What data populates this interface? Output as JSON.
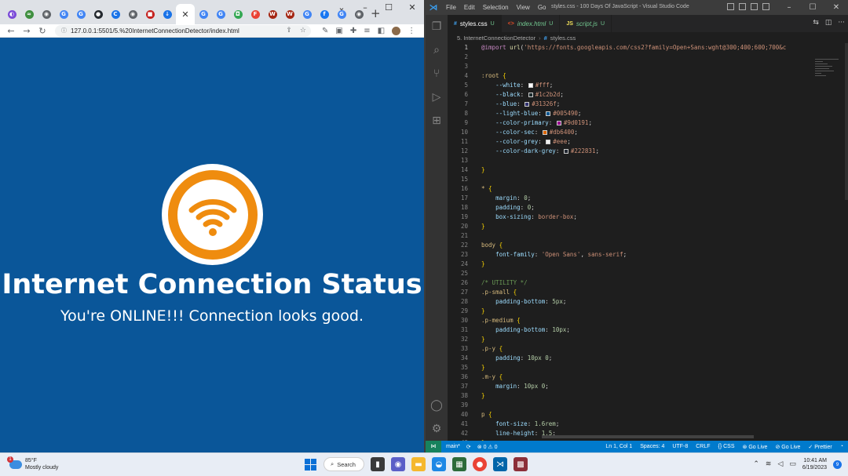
{
  "chrome": {
    "tabs": [
      {
        "icon": "tab-favicon-icon",
        "color": "#7b4bd8",
        "glyph": "◐"
      },
      {
        "icon": "tab-favicon-icon",
        "color": "#3f8f3f",
        "glyph": "≈"
      },
      {
        "icon": "tab-favicon-icon",
        "color": "#5f6368",
        "glyph": "◉"
      },
      {
        "icon": "google-icon",
        "color": "#4285f4",
        "glyph": "G"
      },
      {
        "icon": "google-icon",
        "color": "#4285f4",
        "glyph": "G"
      },
      {
        "icon": "github-icon",
        "color": "#24292f",
        "glyph": "●"
      },
      {
        "icon": "tab-favicon-icon",
        "color": "#1a73e8",
        "glyph": "C"
      },
      {
        "icon": "tab-favicon-icon",
        "color": "#5f6368",
        "glyph": "◉"
      },
      {
        "icon": "tab-favicon-icon",
        "color": "#c5221f",
        "glyph": "■"
      },
      {
        "icon": "download-icon",
        "color": "#1a73e8",
        "glyph": "↓"
      }
    ],
    "tabs_after": [
      {
        "icon": "google-icon",
        "color": "#4285f4",
        "glyph": "G"
      },
      {
        "icon": "google-icon",
        "color": "#4285f4",
        "glyph": "G"
      },
      {
        "icon": "tab-favicon-icon",
        "color": "#34a853",
        "glyph": "◘"
      },
      {
        "icon": "tab-favicon-icon",
        "color": "#ea4335",
        "glyph": "F"
      },
      {
        "icon": "tab-favicon-icon",
        "color": "#a52714",
        "glyph": "W"
      },
      {
        "icon": "tab-favicon-icon",
        "color": "#a52714",
        "glyph": "W"
      },
      {
        "icon": "google-icon",
        "color": "#4285f4",
        "glyph": "G"
      },
      {
        "icon": "facebook-icon",
        "color": "#1877f2",
        "glyph": "f"
      },
      {
        "icon": "google-icon",
        "color": "#4285f4",
        "glyph": "G"
      },
      {
        "icon": "tab-favicon-icon",
        "color": "#5f6368",
        "glyph": "◉"
      }
    ],
    "url": "127.0.0.1:5501/5.%20InternetConnectionDetector/index.html",
    "win_min": "⌄",
    "win_restore": "–",
    "win_max": "☐",
    "win_close": "✕"
  },
  "page": {
    "title": "Internet Connection Status",
    "status": "You're ONLINE!!! Connection looks good.",
    "accent": "#ef8c0f",
    "background": "#0a5699"
  },
  "vscode": {
    "menu": [
      "File",
      "Edit",
      "Selection",
      "View",
      "Go",
      "···"
    ],
    "window_title": "styles.css - 100 Days Of JavaScript - Visual Studio Code",
    "tabs": [
      {
        "label": "styles.css",
        "badge": "U",
        "type": "css",
        "active": true
      },
      {
        "label": "index.html",
        "badge": "U",
        "type": "html",
        "active": false
      },
      {
        "label": "script.js",
        "badge": "U",
        "type": "js",
        "active": false
      }
    ],
    "breadcrumb": [
      "5. InternetConnectionDetector",
      "styles.css"
    ],
    "status": {
      "branch": "main*",
      "sync": "⟳",
      "problems": "⊗ 0 ⚠ 0",
      "position": "Ln 1, Col 1",
      "spaces": "Spaces: 4",
      "encoding": "UTF-8",
      "eol": "CRLF",
      "language": "{} CSS",
      "golive1": "⊛ Go Live",
      "golive2": "⊘ Go Live",
      "prettier": "✓ Prettier",
      "bell": "🔔"
    }
  },
  "code_lines": [
    [
      {
        "c": "kw",
        "t": "@import"
      },
      {
        "c": "pun",
        "t": " "
      },
      {
        "c": "fn",
        "t": "url"
      },
      {
        "c": "pun",
        "t": "("
      },
      {
        "c": "val",
        "t": "'https://fonts.googleapis.com/css2?family=Open+Sans:wght@300;400;600;700&c"
      }
    ],
    [],
    [],
    [
      {
        "c": "sel",
        "t": ":root"
      },
      {
        "c": "pun",
        "t": " "
      },
      {
        "c": "br",
        "t": "{"
      }
    ],
    [
      {
        "c": "pun",
        "t": "    "
      },
      {
        "c": "prop",
        "t": "--white"
      },
      {
        "c": "pun",
        "t": ": "
      },
      {
        "c": "sw",
        "t": "#ffffff"
      },
      {
        "c": "val",
        "t": "#fff"
      },
      {
        "c": "pun",
        "t": ";"
      }
    ],
    [
      {
        "c": "pun",
        "t": "    "
      },
      {
        "c": "prop",
        "t": "--black"
      },
      {
        "c": "pun",
        "t": ": "
      },
      {
        "c": "sw",
        "t": "#1c2b2d"
      },
      {
        "c": "val",
        "t": "#1c2b2d"
      },
      {
        "c": "pun",
        "t": ";"
      }
    ],
    [
      {
        "c": "pun",
        "t": "    "
      },
      {
        "c": "prop",
        "t": "--blue"
      },
      {
        "c": "pun",
        "t": ": "
      },
      {
        "c": "sw",
        "t": "#31326f"
      },
      {
        "c": "val",
        "t": "#31326f"
      },
      {
        "c": "pun",
        "t": ";"
      }
    ],
    [
      {
        "c": "pun",
        "t": "    "
      },
      {
        "c": "prop",
        "t": "--light-blue"
      },
      {
        "c": "pun",
        "t": ": "
      },
      {
        "c": "sw",
        "t": "#005490"
      },
      {
        "c": "val",
        "t": "#005490"
      },
      {
        "c": "pun",
        "t": ";"
      }
    ],
    [
      {
        "c": "pun",
        "t": "    "
      },
      {
        "c": "prop",
        "t": "--color-primary"
      },
      {
        "c": "pun",
        "t": ": "
      },
      {
        "c": "sw",
        "t": "#9d0191"
      },
      {
        "c": "val",
        "t": "#9d0191"
      },
      {
        "c": "pun",
        "t": ";"
      }
    ],
    [
      {
        "c": "pun",
        "t": "    "
      },
      {
        "c": "prop",
        "t": "--color-sec"
      },
      {
        "c": "pun",
        "t": ": "
      },
      {
        "c": "sw",
        "t": "#db6400"
      },
      {
        "c": "val",
        "t": "#db6400"
      },
      {
        "c": "pun",
        "t": ";"
      }
    ],
    [
      {
        "c": "pun",
        "t": "    "
      },
      {
        "c": "prop",
        "t": "--color-grey"
      },
      {
        "c": "pun",
        "t": ": "
      },
      {
        "c": "sw",
        "t": "#eeeeee"
      },
      {
        "c": "val",
        "t": "#eee"
      },
      {
        "c": "pun",
        "t": ";"
      }
    ],
    [
      {
        "c": "pun",
        "t": "    "
      },
      {
        "c": "prop",
        "t": "--color-dark-grey"
      },
      {
        "c": "pun",
        "t": ": "
      },
      {
        "c": "sw",
        "t": "#222831"
      },
      {
        "c": "val",
        "t": "#222831"
      },
      {
        "c": "pun",
        "t": ";"
      }
    ],
    [],
    [
      {
        "c": "br",
        "t": "}"
      }
    ],
    [],
    [
      {
        "c": "sel",
        "t": "*"
      },
      {
        "c": "pun",
        "t": " "
      },
      {
        "c": "br",
        "t": "{"
      }
    ],
    [
      {
        "c": "pun",
        "t": "    "
      },
      {
        "c": "prop",
        "t": "margin"
      },
      {
        "c": "pun",
        "t": ": "
      },
      {
        "c": "num",
        "t": "0"
      },
      {
        "c": "pun",
        "t": ";"
      }
    ],
    [
      {
        "c": "pun",
        "t": "    "
      },
      {
        "c": "prop",
        "t": "padding"
      },
      {
        "c": "pun",
        "t": ": "
      },
      {
        "c": "num",
        "t": "0"
      },
      {
        "c": "pun",
        "t": ";"
      }
    ],
    [
      {
        "c": "pun",
        "t": "    "
      },
      {
        "c": "prop",
        "t": "box-sizing"
      },
      {
        "c": "pun",
        "t": ": "
      },
      {
        "c": "val",
        "t": "border-box"
      },
      {
        "c": "pun",
        "t": ";"
      }
    ],
    [
      {
        "c": "br",
        "t": "}"
      }
    ],
    [],
    [
      {
        "c": "sel",
        "t": "body"
      },
      {
        "c": "pun",
        "t": " "
      },
      {
        "c": "br",
        "t": "{"
      }
    ],
    [
      {
        "c": "pun",
        "t": "    "
      },
      {
        "c": "prop",
        "t": "font-family"
      },
      {
        "c": "pun",
        "t": ": "
      },
      {
        "c": "val",
        "t": "'Open Sans'"
      },
      {
        "c": "pun",
        "t": ", "
      },
      {
        "c": "val",
        "t": "sans-serif"
      },
      {
        "c": "pun",
        "t": ";"
      }
    ],
    [
      {
        "c": "br",
        "t": "}"
      }
    ],
    [],
    [
      {
        "c": "cmt",
        "t": "/* UTILITY */"
      }
    ],
    [
      {
        "c": "sel",
        "t": ".p-small"
      },
      {
        "c": "pun",
        "t": " "
      },
      {
        "c": "br",
        "t": "{"
      }
    ],
    [
      {
        "c": "pun",
        "t": "    "
      },
      {
        "c": "prop",
        "t": "padding-bottom"
      },
      {
        "c": "pun",
        "t": ": "
      },
      {
        "c": "num",
        "t": "5px"
      },
      {
        "c": "pun",
        "t": ";"
      }
    ],
    [
      {
        "c": "br",
        "t": "}"
      }
    ],
    [
      {
        "c": "sel",
        "t": ".p-medium"
      },
      {
        "c": "pun",
        "t": " "
      },
      {
        "c": "br",
        "t": "{"
      }
    ],
    [
      {
        "c": "pun",
        "t": "    "
      },
      {
        "c": "prop",
        "t": "padding-bottom"
      },
      {
        "c": "pun",
        "t": ": "
      },
      {
        "c": "num",
        "t": "10px"
      },
      {
        "c": "pun",
        "t": ";"
      }
    ],
    [
      {
        "c": "br",
        "t": "}"
      }
    ],
    [
      {
        "c": "sel",
        "t": ".p-y"
      },
      {
        "c": "pun",
        "t": " "
      },
      {
        "c": "br",
        "t": "{"
      }
    ],
    [
      {
        "c": "pun",
        "t": "    "
      },
      {
        "c": "prop",
        "t": "padding"
      },
      {
        "c": "pun",
        "t": ": "
      },
      {
        "c": "num",
        "t": "10px 0"
      },
      {
        "c": "pun",
        "t": ";"
      }
    ],
    [
      {
        "c": "br",
        "t": "}"
      }
    ],
    [
      {
        "c": "sel",
        "t": ".m-y"
      },
      {
        "c": "pun",
        "t": " "
      },
      {
        "c": "br",
        "t": "{"
      }
    ],
    [
      {
        "c": "pun",
        "t": "    "
      },
      {
        "c": "prop",
        "t": "margin"
      },
      {
        "c": "pun",
        "t": ": "
      },
      {
        "c": "num",
        "t": "10px 0"
      },
      {
        "c": "pun",
        "t": ";"
      }
    ],
    [
      {
        "c": "br",
        "t": "}"
      }
    ],
    [],
    [
      {
        "c": "sel",
        "t": "p"
      },
      {
        "c": "pun",
        "t": " "
      },
      {
        "c": "br",
        "t": "{"
      }
    ],
    [
      {
        "c": "pun",
        "t": "    "
      },
      {
        "c": "prop",
        "t": "font-size"
      },
      {
        "c": "pun",
        "t": ": "
      },
      {
        "c": "num",
        "t": "1.6rem"
      },
      {
        "c": "pun",
        "t": ";"
      }
    ],
    [
      {
        "c": "pun",
        "t": "    "
      },
      {
        "c": "prop",
        "t": "line-height"
      },
      {
        "c": "pun",
        "t": ": "
      },
      {
        "c": "num",
        "t": "1.5"
      },
      {
        "c": "pun",
        "t": ";"
      }
    ],
    [
      {
        "c": "br",
        "t": "}"
      }
    ]
  ],
  "taskbar": {
    "temp": "85°F",
    "condition": "Mostly cloudy",
    "weather_badge": "1",
    "search_label": "Search",
    "time": "10:41 AM",
    "date": "6/19/2023",
    "notifications": "9"
  }
}
